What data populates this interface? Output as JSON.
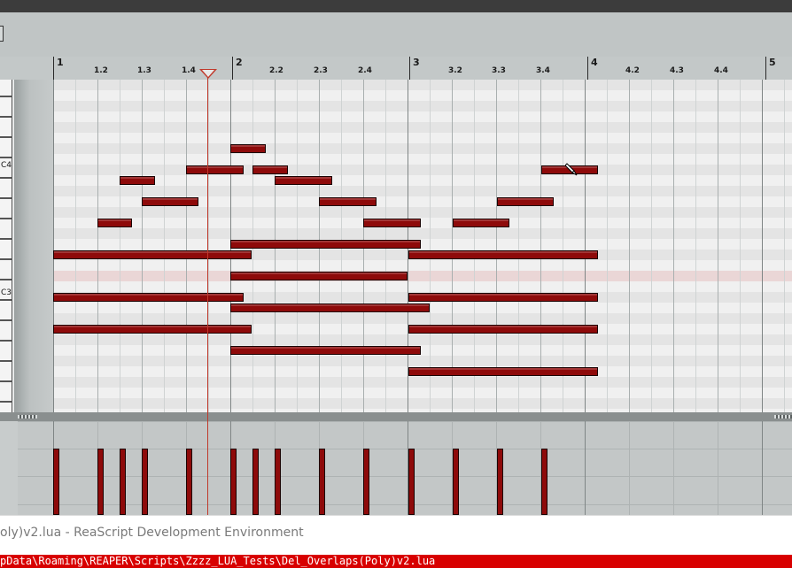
{
  "colors": {
    "note_fill": "#8e0a0a",
    "playhead": "#c0392b",
    "grid_bg": "#ececec",
    "path_bar": "#d80000"
  },
  "ruler": {
    "labels": [
      "1",
      "1.2",
      "1.3",
      "1.4",
      "2",
      "2.2",
      "2.3",
      "2.4",
      "3",
      "3.2",
      "3.3",
      "3.4",
      "4",
      "4.2",
      "4.3",
      "4.4",
      "5"
    ]
  },
  "keyboard": {
    "labels": [
      "C4",
      "C3"
    ]
  },
  "cursor": {
    "icon": "pencil-cursor-icon"
  },
  "ide": {
    "title": "oly)v2.lua - ReaScript Development Environment",
    "path": "pData\\Roaming\\REAPER\\Scripts\\Zzzz_LUA_Tests\\Del_Overlaps(Poly)v2.lua"
  }
}
